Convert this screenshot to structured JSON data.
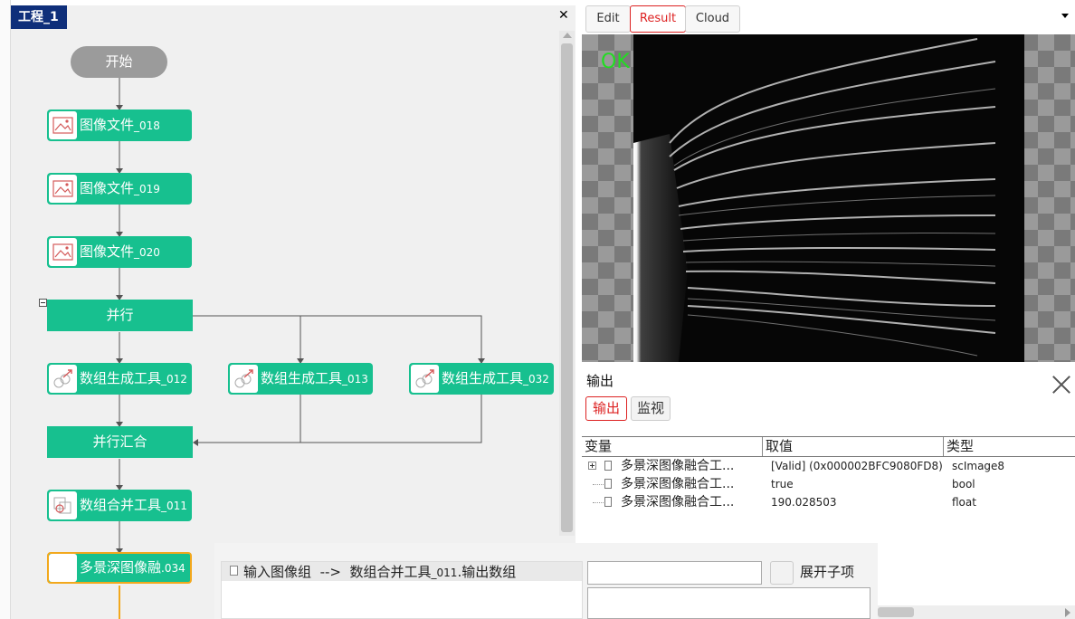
{
  "project": {
    "tab_label": "工程_1"
  },
  "flow": {
    "start": "开始",
    "nodes": [
      {
        "label": "图像文件",
        "suffix": "_018"
      },
      {
        "label": "图像文件",
        "suffix": "_019"
      },
      {
        "label": "图像文件",
        "suffix": "_020"
      },
      {
        "label": "并行",
        "suffix": ""
      },
      {
        "label": "数组生成工具",
        "suffix": "_012"
      },
      {
        "label": "数组生成工具",
        "suffix": "_013"
      },
      {
        "label": "数组生成工具",
        "suffix": "_032"
      },
      {
        "label": "并行汇合",
        "suffix": ""
      },
      {
        "label": "数组合并工具",
        "suffix": "_011"
      },
      {
        "label": "多景深图像融",
        "suffix": ".034"
      }
    ]
  },
  "right_panel": {
    "tabs": [
      "Edit",
      "Result",
      "Cloud"
    ],
    "active_tab": "Result",
    "viewer": {
      "status": "OK",
      "status_color": "#22dd22"
    }
  },
  "output": {
    "title": "输出",
    "subtabs": [
      "输出",
      "监视"
    ],
    "columns": [
      "变量",
      "取值",
      "类型"
    ],
    "rows": [
      {
        "name": "多景深图像融合工...",
        "value": "[Valid] (0x000002BFC9080FD8)",
        "type": "scImage8"
      },
      {
        "name": "多景深图像融合工...",
        "value": "true",
        "type": "bool"
      },
      {
        "name": "多景深图像融合工...",
        "value": "190.028503",
        "type": "float"
      }
    ]
  },
  "property": {
    "input_label": "输入图像组",
    "arrow": "-->",
    "source_name": "数组合并工具",
    "source_suffix": "_011",
    "source_field": ".输出数组",
    "expand_label": "展开子项"
  },
  "colors": {
    "node": "#17c08f",
    "selected_border": "#f2a81d",
    "project_tab": "#0f2f7a",
    "accent_red": "#dd2222"
  }
}
